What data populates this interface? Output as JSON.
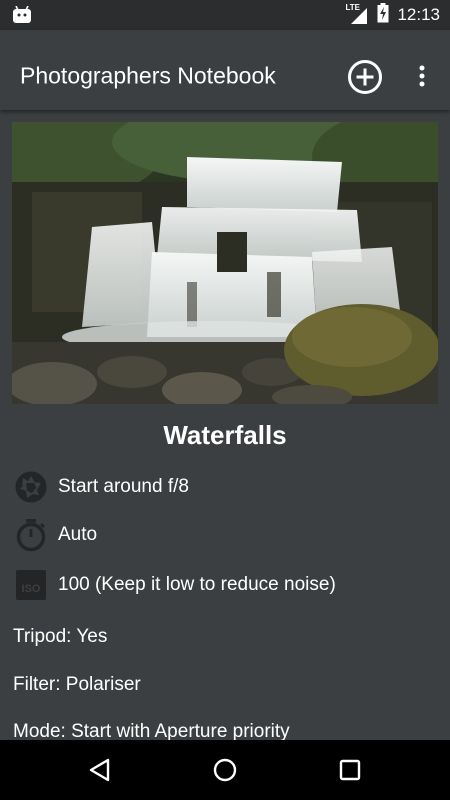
{
  "status_bar": {
    "network": "LTE",
    "time": "12:13",
    "icons": [
      "android-debug-icon",
      "lte-signal-icon",
      "battery-charging-icon"
    ]
  },
  "app_bar": {
    "title": "Photographers Notebook",
    "icons": [
      "add-circle-icon",
      "overflow-menu-icon"
    ]
  },
  "card": {
    "image": "waterfall-photo",
    "title": "Waterfalls",
    "settings": [
      {
        "icon": "aperture-icon",
        "text": "Start around f/8"
      },
      {
        "icon": "stopwatch-icon",
        "text": "Auto"
      },
      {
        "icon": "iso-icon",
        "text": "100 (Keep it low to reduce noise)"
      }
    ],
    "details": [
      "Tripod: Yes",
      "Filter: Polariser",
      "Mode: Start with Aperture priority"
    ]
  },
  "nav_bar": {
    "icons": [
      "back-triangle-icon",
      "home-circle-icon",
      "recents-square-icon"
    ]
  }
}
